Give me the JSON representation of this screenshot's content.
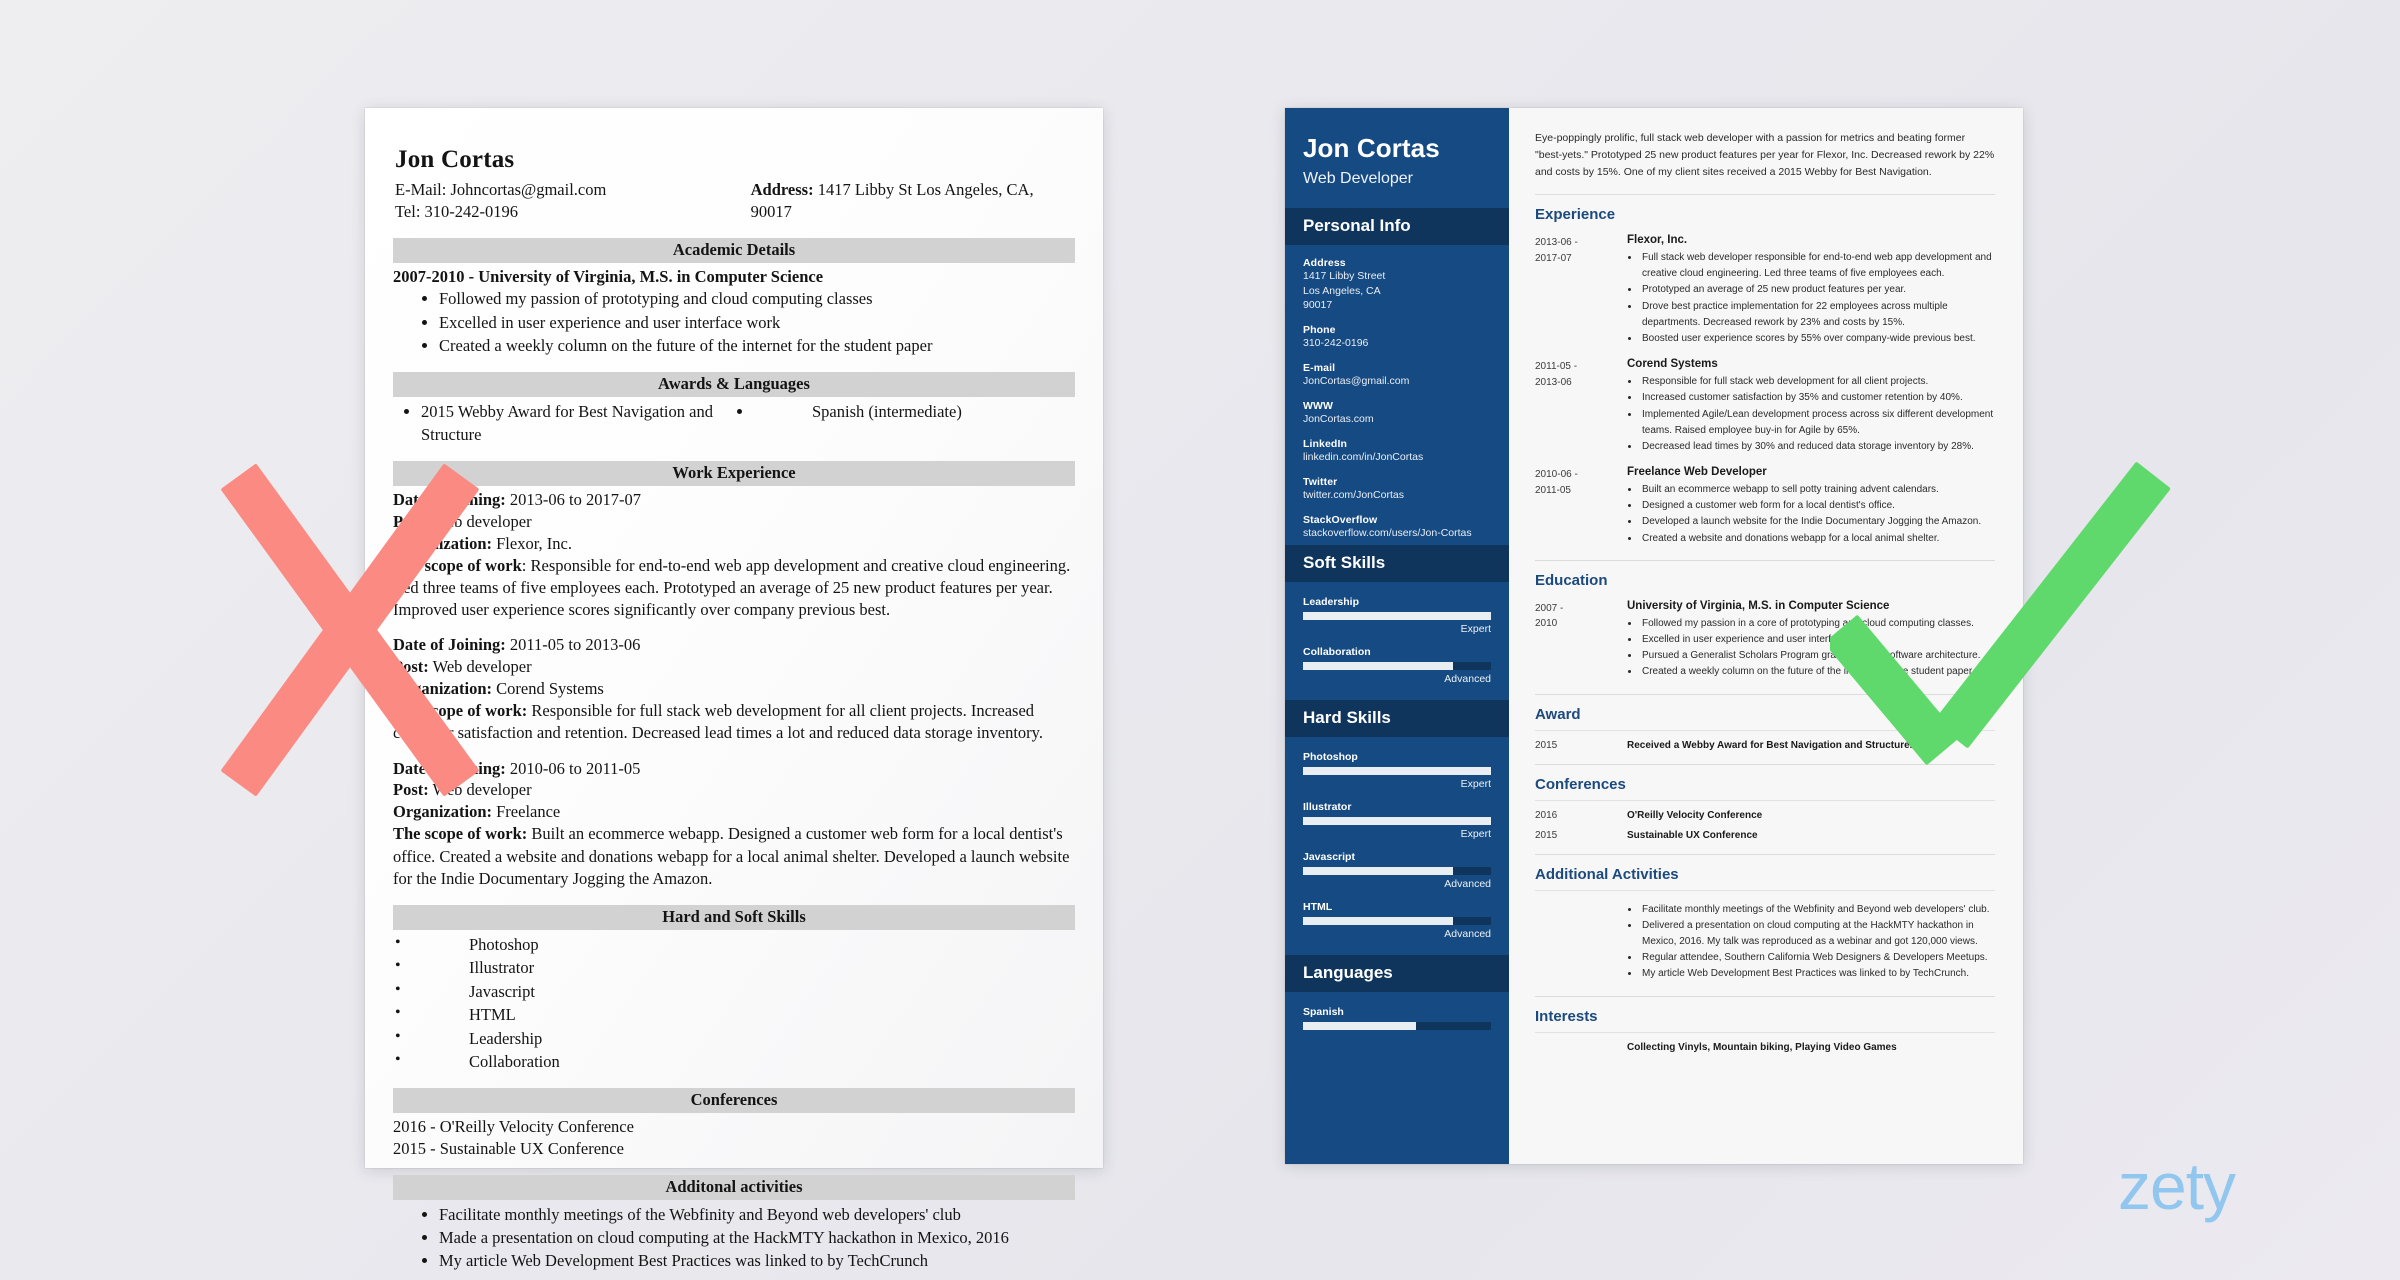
{
  "background": {
    "color": "#ebebef",
    "accent_blue": "#164a82",
    "x_mark_color": "#fa8a82",
    "check_mark_color": "#5fd96b",
    "logo_color": "#8dc6ef"
  },
  "logo": {
    "text": "zety"
  },
  "bad_resume": {
    "name": "Jon Cortas",
    "email_line": "E-Mail: Johncortas@gmail.com",
    "tel_line": "Tel: 310-242-0196",
    "address_label": "Address:",
    "address_value": "1417 Libby St Los Angeles, CA, 90017",
    "sections": {
      "academic": {
        "heading": "Academic Details",
        "degree_line": "2007-2010 - University of Virginia, M.S. in Computer Science",
        "bullets": [
          "Followed my passion of prototyping and cloud computing classes",
          "Excelled in user experience and user interface work",
          "Created a weekly column on the future of the internet for the student paper"
        ]
      },
      "awards": {
        "heading": "Awards & Languages",
        "awards": [
          "2015 Webby Award for Best Navigation and Structure"
        ],
        "languages": [
          "Spanish (intermediate)"
        ]
      },
      "work": {
        "heading": "Work Experience",
        "jobs": [
          {
            "date_label": "Date of Joining:",
            "date_value": " 2013-06 to 2017-07",
            "post_label": "Post:",
            "post_value": " Web developer",
            "org_label": "Organization:",
            "org_value": " Flexor, Inc.",
            "scope_label": "The scope of work",
            "scope_value": ": Responsible for end-to-end web app development and creative cloud engineering. Led three teams of five employees each. Prototyped an average of 25 new product features per year. Improved user experience scores significantly over company previous best."
          },
          {
            "date_label": "Date of Joining:",
            "date_value": " 2011-05 to 2013-06",
            "post_label": "Post:",
            "post_value": " Web developer",
            "org_label": "Organization:",
            "org_value": " Corend Systems",
            "scope_label": "The scope of work:",
            "scope_value": " Responsible for full stack web development for all client projects. Increased customer satisfaction and retention. Decreased lead times a lot and reduced data storage inventory."
          },
          {
            "date_label": "Date of Joining:",
            "date_value": " 2010-06 to 2011-05",
            "post_label": "Post:",
            "post_value": " Web developer",
            "org_label": "Organization:",
            "org_value": "  Freelance",
            "scope_label": "The scope of work:",
            "scope_value": " Built an ecommerce webapp. Designed a customer web form for a local dentist's office. Created a website and donations webapp for a local animal shelter. Developed a launch website for the Indie Documentary Jogging the Amazon."
          }
        ]
      },
      "skills": {
        "heading": "Hard and Soft Skills",
        "items": [
          "Photoshop",
          "Illustrator",
          "Javascript",
          "HTML",
          "Leadership",
          "Collaboration"
        ]
      },
      "conferences": {
        "heading": "Conferences",
        "items": [
          "2016 - O'Reilly Velocity Conference",
          "2015 - Sustainable UX Conference"
        ]
      },
      "additional": {
        "heading": "Additonal activities",
        "items": [
          "Facilitate monthly meetings of the Webfinity and Beyond web developers' club",
          "Made a presentation on cloud computing at the HackMTY hackathon in Mexico, 2016",
          "My article Web Development Best Practices was linked to by TechCrunch"
        ]
      }
    }
  },
  "good_resume": {
    "sidebar": {
      "name": "Jon Cortas",
      "role": "Web Developer",
      "personal_info_heading": "Personal Info",
      "fields": [
        {
          "label": "Address",
          "value": "1417 Libby Street\nLos Angeles, CA\n90017"
        },
        {
          "label": "Phone",
          "value": "310-242-0196"
        },
        {
          "label": "E-mail",
          "value": "JonCortas@gmail.com"
        },
        {
          "label": "WWW",
          "value": "JonCortas.com"
        },
        {
          "label": "LinkedIn",
          "value": "linkedin.com/in/JonCortas"
        },
        {
          "label": "Twitter",
          "value": "twitter.com/JonCortas"
        },
        {
          "label": "StackOverflow",
          "value": "stackoverflow.com/users/Jon-Cortas"
        }
      ],
      "soft_skills_heading": "Soft Skills",
      "soft_skills": [
        {
          "name": "Leadership",
          "level": "Expert",
          "percent": 100
        },
        {
          "name": "Collaboration",
          "level": "Advanced",
          "percent": 80
        }
      ],
      "hard_skills_heading": "Hard Skills",
      "hard_skills": [
        {
          "name": "Photoshop",
          "level": "Expert",
          "percent": 100
        },
        {
          "name": "Illustrator",
          "level": "Expert",
          "percent": 100
        },
        {
          "name": "Javascript",
          "level": "Advanced",
          "percent": 80
        },
        {
          "name": "HTML",
          "level": "Advanced",
          "percent": 80
        }
      ],
      "languages_heading": "Languages",
      "languages": [
        {
          "name": "Spanish",
          "level": "",
          "percent": 60
        }
      ]
    },
    "main": {
      "summary": "Eye-poppingly prolific, full stack web developer with a passion for metrics and beating former \"best-yets.\" Prototyped 25 new product features per year for Flexor, Inc. Decreased rework by 22% and costs by 15%. One of my client sites received a 2015 Webby for Best Navigation.",
      "experience_heading": "Experience",
      "experience": [
        {
          "date": "2013-06 -\n2017-07",
          "title": "Flexor, Inc.",
          "bullets": [
            "Full stack web developer responsible for end-to-end web app development and creative cloud engineering. Led three teams of five employees each.",
            "Prototyped an average of 25 new product features per year.",
            "Drove best practice implementation for 22 employees across multiple departments. Decreased rework by 23% and costs by 15%.",
            "Boosted user experience scores by 55% over company-wide previous best."
          ]
        },
        {
          "date": "2011-05 -\n2013-06",
          "title": "Corend Systems",
          "bullets": [
            "Responsible for full stack web development for all client projects.",
            "Increased customer satisfaction by 35% and customer retention by 40%.",
            "Implemented Agile/Lean development process across six different development teams. Raised employee buy-in for Agile by 65%.",
            "Decreased lead times by 30% and reduced data storage inventory by 28%."
          ]
        },
        {
          "date": "2010-06 -\n2011-05",
          "title": "Freelance Web Developer",
          "bullets": [
            "Built an ecommerce webapp to sell potty training advent calendars.",
            "Designed a customer web form for a local dentist's office.",
            "Developed a launch website for the Indie Documentary Jogging the Amazon.",
            "Created a website and donations webapp for a local animal shelter."
          ]
        }
      ],
      "education_heading": "Education",
      "education": [
        {
          "date": "2007 -\n2010",
          "title": "University of Virginia, M.S. in Computer Science",
          "bullets": [
            "Followed my passion in a core of prototyping and cloud computing classes.",
            "Excelled in user experience and user interface work.",
            "Pursued a Generalist Scholars Program grant to study software architecture.",
            "Created a weekly column on the future of the internet for the student paper."
          ]
        }
      ],
      "award_heading": "Award",
      "awards": [
        {
          "date": "2015",
          "text": "Received a Webby Award for Best Navigation and Structure."
        }
      ],
      "conferences_heading": "Conferences",
      "conferences": [
        {
          "date": "2016",
          "text": "O'Reilly Velocity Conference"
        },
        {
          "date": "2015",
          "text": "Sustainable UX Conference"
        }
      ],
      "additional_heading": "Additional Activities",
      "additional": [
        "Facilitate monthly meetings of the Webfinity and Beyond web developers' club.",
        "Delivered a presentation on cloud computing at the HackMTY hackathon in Mexico, 2016. My talk was reproduced as a webinar and got 120,000 views.",
        "Regular attendee, Southern California Web Designers & Developers Meetups.",
        "My article Web Development Best Practices was linked to by TechCrunch."
      ],
      "interests_heading": "Interests",
      "interests_text": "Collecting Vinyls, Mountain biking, Playing Video Games"
    }
  }
}
